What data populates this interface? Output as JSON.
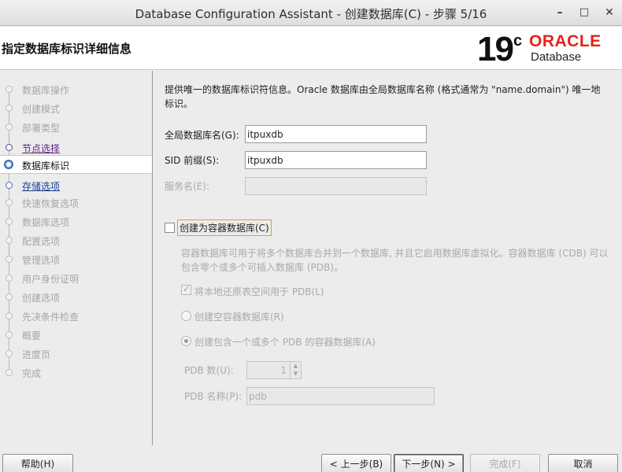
{
  "window": {
    "title": "Database Configuration Assistant - 创建数据库(C) - 步骤 5/16",
    "minimize": "–",
    "maximize": "□",
    "close": "✕"
  },
  "header": {
    "title": "指定数据库标识详细信息",
    "logo": {
      "version": "19",
      "sup": "c",
      "brand": "ORACLE",
      "product": "Database"
    }
  },
  "sidebar": {
    "steps": [
      {
        "label": "数据库操作",
        "state": "disabled"
      },
      {
        "label": "创建模式",
        "state": "disabled"
      },
      {
        "label": "部署类型",
        "state": "disabled"
      },
      {
        "label": "节点选择",
        "state": "done"
      },
      {
        "label": "数据库标识",
        "state": "active"
      },
      {
        "label": "存储选项",
        "state": "next"
      },
      {
        "label": "快速恢复选项",
        "state": "disabled"
      },
      {
        "label": "数据库选项",
        "state": "disabled"
      },
      {
        "label": "配置选项",
        "state": "disabled"
      },
      {
        "label": "管理选项",
        "state": "disabled"
      },
      {
        "label": "用户身份证明",
        "state": "disabled"
      },
      {
        "label": "创建选项",
        "state": "disabled"
      },
      {
        "label": "先决条件检查",
        "state": "disabled"
      },
      {
        "label": "概要",
        "state": "disabled"
      },
      {
        "label": "进度页",
        "state": "disabled"
      },
      {
        "label": "完成",
        "state": "disabled"
      }
    ]
  },
  "main": {
    "intro": "提供唯一的数据库标识符信息。Oracle 数据库由全局数据库名称 (格式通常为 \"name.domain\") 唯一地标识。",
    "global_db_name": {
      "label": "全局数据库名(G):",
      "value": "itpuxdb"
    },
    "sid_prefix": {
      "label": "SID 前缀(S):",
      "value": "itpuxdb"
    },
    "service_name": {
      "label": "服务名(E):",
      "value": ""
    },
    "create_cdb": {
      "label": "创建为容器数据库(C)",
      "checked": false
    },
    "cdb_description": "容器数据库可用于将多个数据库合并到一个数据库, 并且它启用数据库虚拟化。容器数据库 (CDB) 可以包含零个或多个可插入数据库 (PDB)。",
    "local_undo": {
      "label": "将本地还原表空间用于 PDB(L)",
      "checked": true
    },
    "empty_cdb": {
      "label": "创建空容器数据库(R)",
      "selected": false
    },
    "cdb_with_pdbs": {
      "label": "创建包含一个或多个 PDB 的容器数据库(A)",
      "selected": true
    },
    "pdb_count": {
      "label": "PDB 数(U):",
      "value": "1"
    },
    "pdb_name": {
      "label": "PDB 名称(P):",
      "value": "pdb"
    }
  },
  "buttons": {
    "help": "帮助(H)",
    "back": "< 上一步(B)",
    "next": "下一步(N) >",
    "finish": "完成(F)",
    "cancel": "取消"
  }
}
